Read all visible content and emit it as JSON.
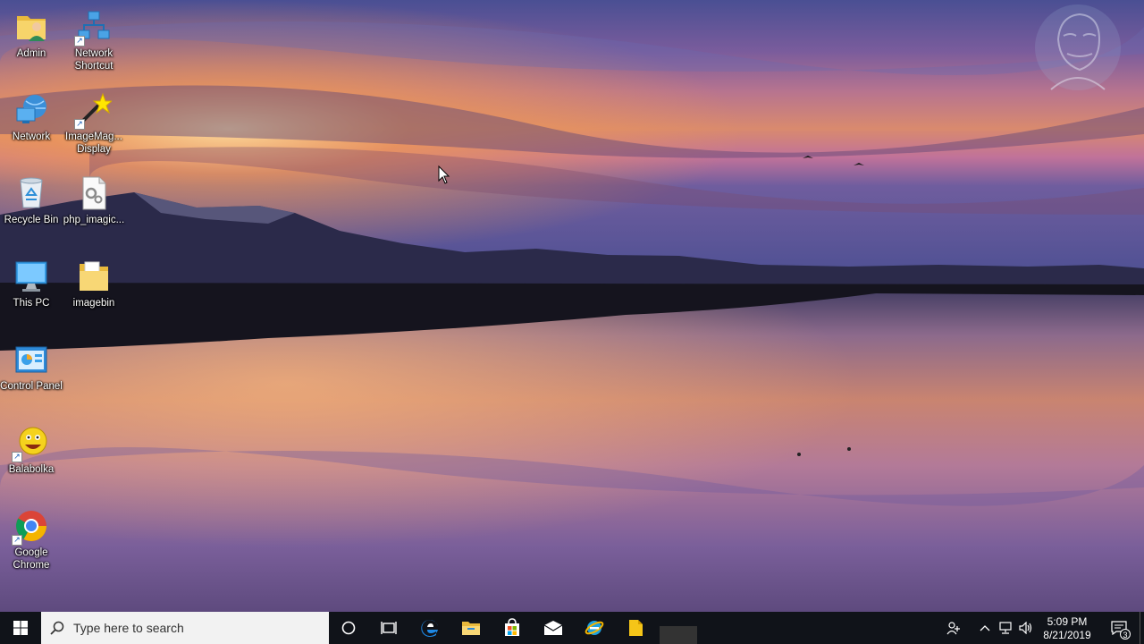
{
  "desktop": {
    "icons": [
      {
        "label": "Admin",
        "icon": "user-folder-icon"
      },
      {
        "label": "Network Shortcut",
        "icon": "network-shortcut-icon"
      },
      {
        "label": "Network",
        "icon": "network-globe-icon"
      },
      {
        "label": "ImageMag... Display",
        "icon": "imagemagick-wand-icon"
      },
      {
        "label": "Recycle Bin",
        "icon": "recycle-bin-icon"
      },
      {
        "label": "php_imagic...",
        "icon": "dll-file-icon"
      },
      {
        "label": "This PC",
        "icon": "this-pc-icon"
      },
      {
        "label": "imagebin",
        "icon": "folder-icon"
      },
      {
        "label": "Control Panel",
        "icon": "control-panel-icon"
      },
      {
        "label": "Balabolka",
        "icon": "balabolka-icon"
      },
      {
        "label": "Google Chrome",
        "icon": "chrome-icon"
      }
    ]
  },
  "taskbar": {
    "search_placeholder": "Type here to search",
    "pinned": [
      "cortana-icon",
      "task-view-icon",
      "edge-icon",
      "file-explorer-icon",
      "store-icon",
      "mail-icon",
      "ie-icon",
      "sticky-folder-icon"
    ],
    "clock": {
      "time": "5:09 PM",
      "date": "8/21/2019"
    },
    "notification_count": "3"
  },
  "colors": {
    "taskbar_bg": "#101319",
    "search_bg": "#f2f2f2",
    "label_text": "#ffffff"
  }
}
